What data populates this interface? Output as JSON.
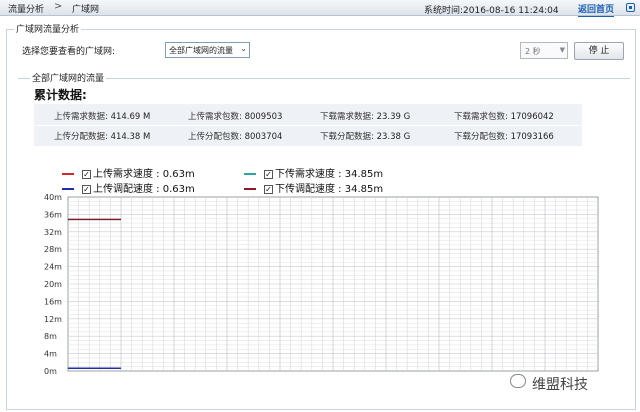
{
  "breadcrumb": {
    "items": [
      "流量分析",
      "广域网"
    ],
    "separator": ">"
  },
  "header": {
    "system_time": "系统时间:2016-08-16 11:24:04",
    "home_link": "返回首页"
  },
  "panel": {
    "title": "广域网流量分析",
    "select_label": "选择您要查看的广域网:",
    "select_value": "全部广域网的流量",
    "interval_value": "2 秒",
    "stop_button": "停 止"
  },
  "inner": {
    "title": "全部广域网的流量",
    "stats_title": "累计数据:",
    "row1": [
      {
        "label": "上传需求数据:",
        "value": "414.69 M"
      },
      {
        "label": "上传需求包数:",
        "value": "8009503"
      },
      {
        "label": "下载需求数据:",
        "value": "23.39 G"
      },
      {
        "label": "下载需求包数:",
        "value": "17096042"
      }
    ],
    "row2": [
      {
        "label": "上传分配数据:",
        "value": "414.38 M"
      },
      {
        "label": "上传分配包数:",
        "value": "8003704"
      },
      {
        "label": "下载分配数据:",
        "value": "23.38 G"
      },
      {
        "label": "下载分配包数:",
        "value": "17093166"
      }
    ]
  },
  "legend": [
    {
      "label": "上传需求速度 : 0.63m",
      "color": "#d62728",
      "checked": true
    },
    {
      "label": "下传需求速度 : 34.85m",
      "color": "#2ca5a8",
      "checked": true
    },
    {
      "label": "上传调配速度 : 0.63m",
      "color": "#1f2fa8",
      "checked": true
    },
    {
      "label": "下传调配速度 : 34.85m",
      "color": "#8b1a2a",
      "checked": true
    }
  ],
  "chart_data": {
    "type": "line",
    "y_ticks": [
      "40m",
      "36m",
      "32m",
      "28m",
      "24m",
      "20m",
      "16m",
      "12m",
      "8m",
      "4m",
      "0m"
    ],
    "ylim": [
      0,
      40
    ],
    "grid": true,
    "series": [
      {
        "name": "下传需求速度",
        "color": "#2ca5a8",
        "value": 34.85
      },
      {
        "name": "下传调配速度",
        "color": "#8b1a2a",
        "value": 34.85
      },
      {
        "name": "上传需求速度",
        "color": "#d62728",
        "value": 0.63
      },
      {
        "name": "上传调配速度",
        "color": "#1f2fa8",
        "value": 0.63
      }
    ]
  },
  "watermark": "维盟科技"
}
